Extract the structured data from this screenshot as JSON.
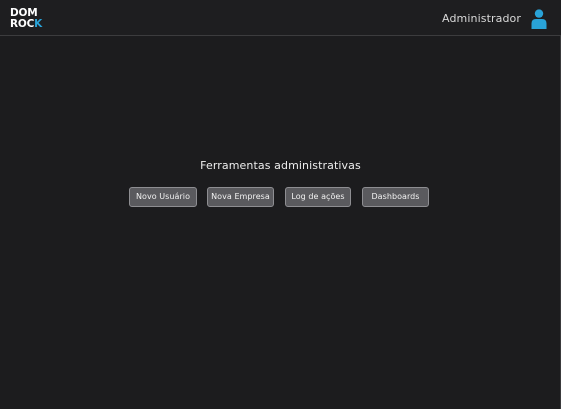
{
  "header": {
    "logo_line1": "DOM",
    "logo_line2_main": "ROC",
    "logo_line2_accent": "K",
    "user_label": "Administrador",
    "user_icon": "user-icon"
  },
  "tools": {
    "title": "Ferramentas administrativas",
    "buttons": [
      {
        "label": "Novo Usuário"
      },
      {
        "label": "Nova Empresa"
      },
      {
        "label": "Log de ações"
      },
      {
        "label": "Dashboards"
      }
    ]
  },
  "colors": {
    "background": "#1c1c1e",
    "accent": "#29a3d8",
    "button": "#5a5a5e"
  }
}
